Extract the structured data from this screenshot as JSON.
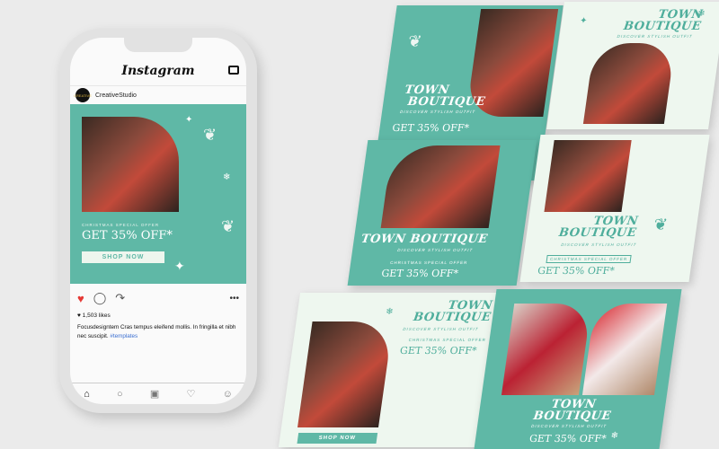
{
  "phone": {
    "app_title": "Instagram",
    "username": "CreativeStudio",
    "avatar_text": "CREATIVE",
    "post": {
      "offer_label": "CHRISTMAS SPECIAL OFFER",
      "offer": "GET 35% OFF*",
      "cta": "SHOP NOW"
    },
    "likes": "1,503 likes",
    "caption": "Focusdesigntem Cras tempus eleifend mollis. In fringilla et  nibh nec suscipit.",
    "hashtag": "#templates",
    "icons": [
      "heart-icon",
      "comment-icon",
      "share-icon",
      "more-icon",
      "home-icon",
      "search-icon",
      "camera-icon",
      "activity-icon",
      "profile-icon",
      "inbox-icon"
    ]
  },
  "cards": [
    {
      "title1": "TOWN",
      "title2": "BOUTIQUE",
      "sub": "DISCOVER STYLISH OUTFIT",
      "offer": "GET 35% OFF*"
    },
    {
      "title1": "TOWN",
      "title2": "BOUTIQUE",
      "sub": "DISCOVER STYLISH OUTFIT"
    },
    {
      "title1": "TOWN BOUTIQUE",
      "sub": "DISCOVER STYLISH OUTFIT",
      "spec": "CHRISTMAS SPECIAL OFFER",
      "offer": "GET 35% OFF*"
    },
    {
      "title1": "TOWN",
      "title2": "BOUTIQUE",
      "sub": "DISCOVER STYLISH OUTFIT",
      "spec": "CHRISTMAS SPECIAL OFFER",
      "offer": "GET 35% OFF*"
    },
    {
      "title1": "TOWN",
      "title2": "BOUTIQUE",
      "sub": "DISCOVER STYLISH OUTFIT",
      "spec": "CHRISTMAS SPECIAL OFFER",
      "offer": "GET 35% OFF*",
      "cta": "SHOP NOW"
    },
    {
      "title1": "TOWN",
      "title2": "BOUTIQUE",
      "sub": "DISCOVER STYLISH OUTFIT",
      "offer": "GET 35% OFF*"
    }
  ],
  "colors": {
    "teal": "#5fb8a6",
    "mint": "#eef7ef",
    "accent_red": "#e53935"
  }
}
